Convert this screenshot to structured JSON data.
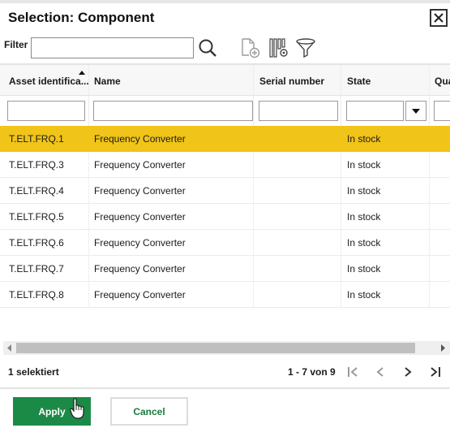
{
  "dialog": {
    "title": "Selection: Component",
    "close_icon": "close-icon"
  },
  "filter": {
    "label": "Filter",
    "value": "",
    "placeholder": ""
  },
  "toolbar": {
    "icons": [
      "search-icon",
      "new-document-icon",
      "column-settings-icon",
      "funnel-filter-icon"
    ]
  },
  "grid": {
    "columns": [
      {
        "label": "Asset identifica...",
        "sorted": "ascending"
      },
      {
        "label": "Name"
      },
      {
        "label": "Serial number"
      },
      {
        "label": "State"
      },
      {
        "label": "Qua"
      }
    ],
    "column_filters": [
      "",
      "",
      "",
      "",
      ""
    ],
    "rows": [
      {
        "asset_id": "T.ELT.FRQ.1",
        "name": "Frequency Converter",
        "serial": "",
        "state": "In stock",
        "selected": true
      },
      {
        "asset_id": "T.ELT.FRQ.3",
        "name": "Frequency Converter",
        "serial": "",
        "state": "In stock",
        "selected": false
      },
      {
        "asset_id": "T.ELT.FRQ.4",
        "name": "Frequency Converter",
        "serial": "",
        "state": "In stock",
        "selected": false
      },
      {
        "asset_id": "T.ELT.FRQ.5",
        "name": "Frequency Converter",
        "serial": "",
        "state": "In stock",
        "selected": false
      },
      {
        "asset_id": "T.ELT.FRQ.6",
        "name": "Frequency Converter",
        "serial": "",
        "state": "In stock",
        "selected": false
      },
      {
        "asset_id": "T.ELT.FRQ.7",
        "name": "Frequency Converter",
        "serial": "",
        "state": "In stock",
        "selected": false
      },
      {
        "asset_id": "T.ELT.FRQ.8",
        "name": "Frequency Converter",
        "serial": "",
        "state": "In stock",
        "selected": false
      }
    ]
  },
  "footer": {
    "selection_count": "1 selektiert",
    "pager_text": "1 - 7 von 9"
  },
  "buttons": {
    "apply": "Apply",
    "cancel": "Cancel"
  },
  "colors": {
    "selected_row": "#f0c419",
    "apply_button": "#1b8a46",
    "cancel_text": "#1b7a40"
  }
}
